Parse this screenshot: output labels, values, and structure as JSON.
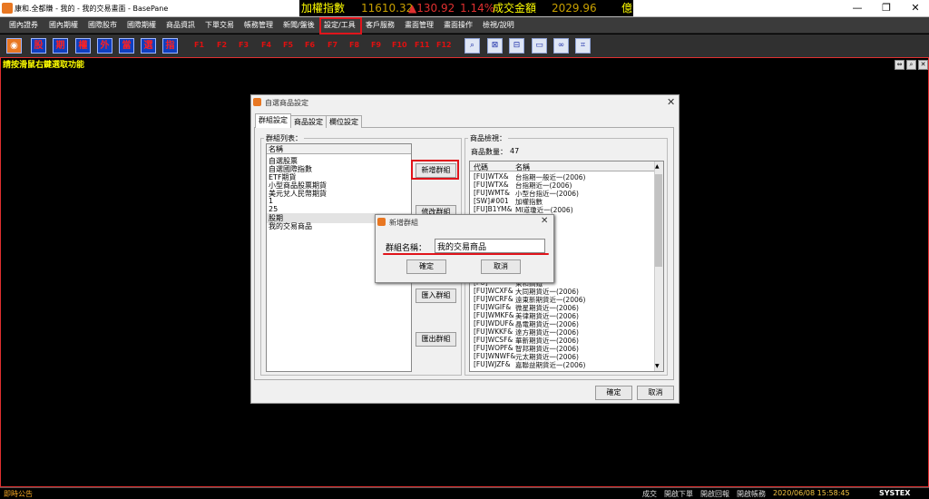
{
  "window": {
    "title": "康和.全都賺 - 我的 - 我的交易畫面 - BasePane",
    "ticker": {
      "index_label": "加權指數",
      "index_value": "11610.32",
      "change": "▲130.92",
      "change_pct": "1.14%",
      "volume_label": "成交金額",
      "volume_value": "2029.96",
      "volume_unit": "億"
    },
    "controls": {
      "minimize": "—",
      "restore": "❐",
      "close": "✕"
    }
  },
  "menubar": [
    "國內證券",
    "國內期權",
    "國際股市",
    "國際期權",
    "商品資訊",
    "下單交易",
    "帳務管理",
    "新聞/盤後",
    "設定/工具",
    "客戶服務",
    "畫面管理",
    "畫面操作",
    "檢視/說明"
  ],
  "toolbar": {
    "quick_buttons": [
      "股",
      "期",
      "權",
      "外",
      "當",
      "選",
      "指"
    ],
    "fkeys": [
      "F1",
      "F2",
      "F3",
      "F4",
      "F5",
      "F6",
      "F7",
      "F8",
      "F9",
      "F10",
      "F11",
      "F12"
    ],
    "tool_icons": [
      "search-icon",
      "window-close-icon",
      "split-icon",
      "layout-icon",
      "link-icon",
      "crop-icon"
    ]
  },
  "pane": {
    "hint": "請按滑鼠右鍵選取功能",
    "controls": [
      "⇔",
      "⌕",
      "✕"
    ]
  },
  "dialog": {
    "title": "自選商品設定",
    "close": "✕",
    "tabs": [
      "群組設定",
      "商品設定",
      "欄位設定"
    ],
    "group_box_label": "群組列表：",
    "group_header": "名稱",
    "groups": [
      "自選股票",
      "自選國際指數",
      "ETF期貨",
      "小型商品股票期貨",
      "美元兌人民幣期貨",
      "1",
      "25",
      "股期",
      "我的交易商品"
    ],
    "buttons": {
      "add": "新增群組",
      "modify": "修改群組",
      "import": "匯入群組",
      "export": "匯出群組",
      "ok": "確定",
      "cancel": "取消"
    },
    "product_box_label": "商品檢視：",
    "product_count_label": "商品數量：",
    "product_count": "47",
    "product_headers": [
      "代碼",
      "名稱"
    ],
    "products": [
      [
        "[FU]WTX&",
        "台指期一般近一(2006)"
      ],
      [
        "[FU]WTX&",
        "台指期近一(2006)"
      ],
      [
        "[FU]WMT&",
        "小型台指近一(2006)"
      ],
      [
        "[SW]#001",
        "加權指數"
      ],
      [
        "[FU]B1YM&",
        "MI道瓊近一(2006)"
      ],
      [
        "",
        "近一(2006)"
      ],
      [
        "",
        "(2006)"
      ],
      [
        "",
        "(2006)"
      ],
      [
        "",
        ""
      ],
      [
        "",
        "近一(2006)"
      ],
      [
        "",
        "(2006)"
      ],
      [
        "",
        "(2006)"
      ],
      [
        "",
        "(2006)"
      ],
      [
        "[FU]",
        "東和鋼鐵"
      ],
      [
        "[FU]WCXF&",
        "大同期貨近一(2006)"
      ],
      [
        "[FU]WCRF&",
        "遠東新期貨近一(2006)"
      ],
      [
        "[FU]WGIF&",
        "微星期貨近一(2006)"
      ],
      [
        "[FU]WMKF&",
        "美律期貨近一(2006)"
      ],
      [
        "[FU]WDUF&",
        "晶電期貨近一(2006)"
      ],
      [
        "[FU]WKKF&",
        "達方期貨近一(2006)"
      ],
      [
        "[FU]WCSF&",
        "華新期貨近一(2006)"
      ],
      [
        "[FU]WOPF&",
        "智邦期貨近一(2006)"
      ],
      [
        "[FU]WNWF&",
        "元太期貨近一(2006)"
      ],
      [
        "[FU]WJZF&",
        "嘉聯益期貨近一(2006)"
      ]
    ]
  },
  "subdialog": {
    "title": "新增群組",
    "close": "✕",
    "label": "群組名稱：",
    "value": "我的交易商品",
    "ok": "確定",
    "cancel": "取消"
  },
  "statusbar": {
    "left": "即時公告",
    "items": [
      "成交",
      "開啟下單",
      "開啟回報",
      "開啟帳務"
    ],
    "datetime": "2020/06/08 15:58:45",
    "brand": "SYSTEX"
  },
  "colors": {
    "highlight": "#e0141b",
    "ticker_text": "#ffff00",
    "menubar": "#3b3b3b",
    "hint": "#ffff00"
  }
}
